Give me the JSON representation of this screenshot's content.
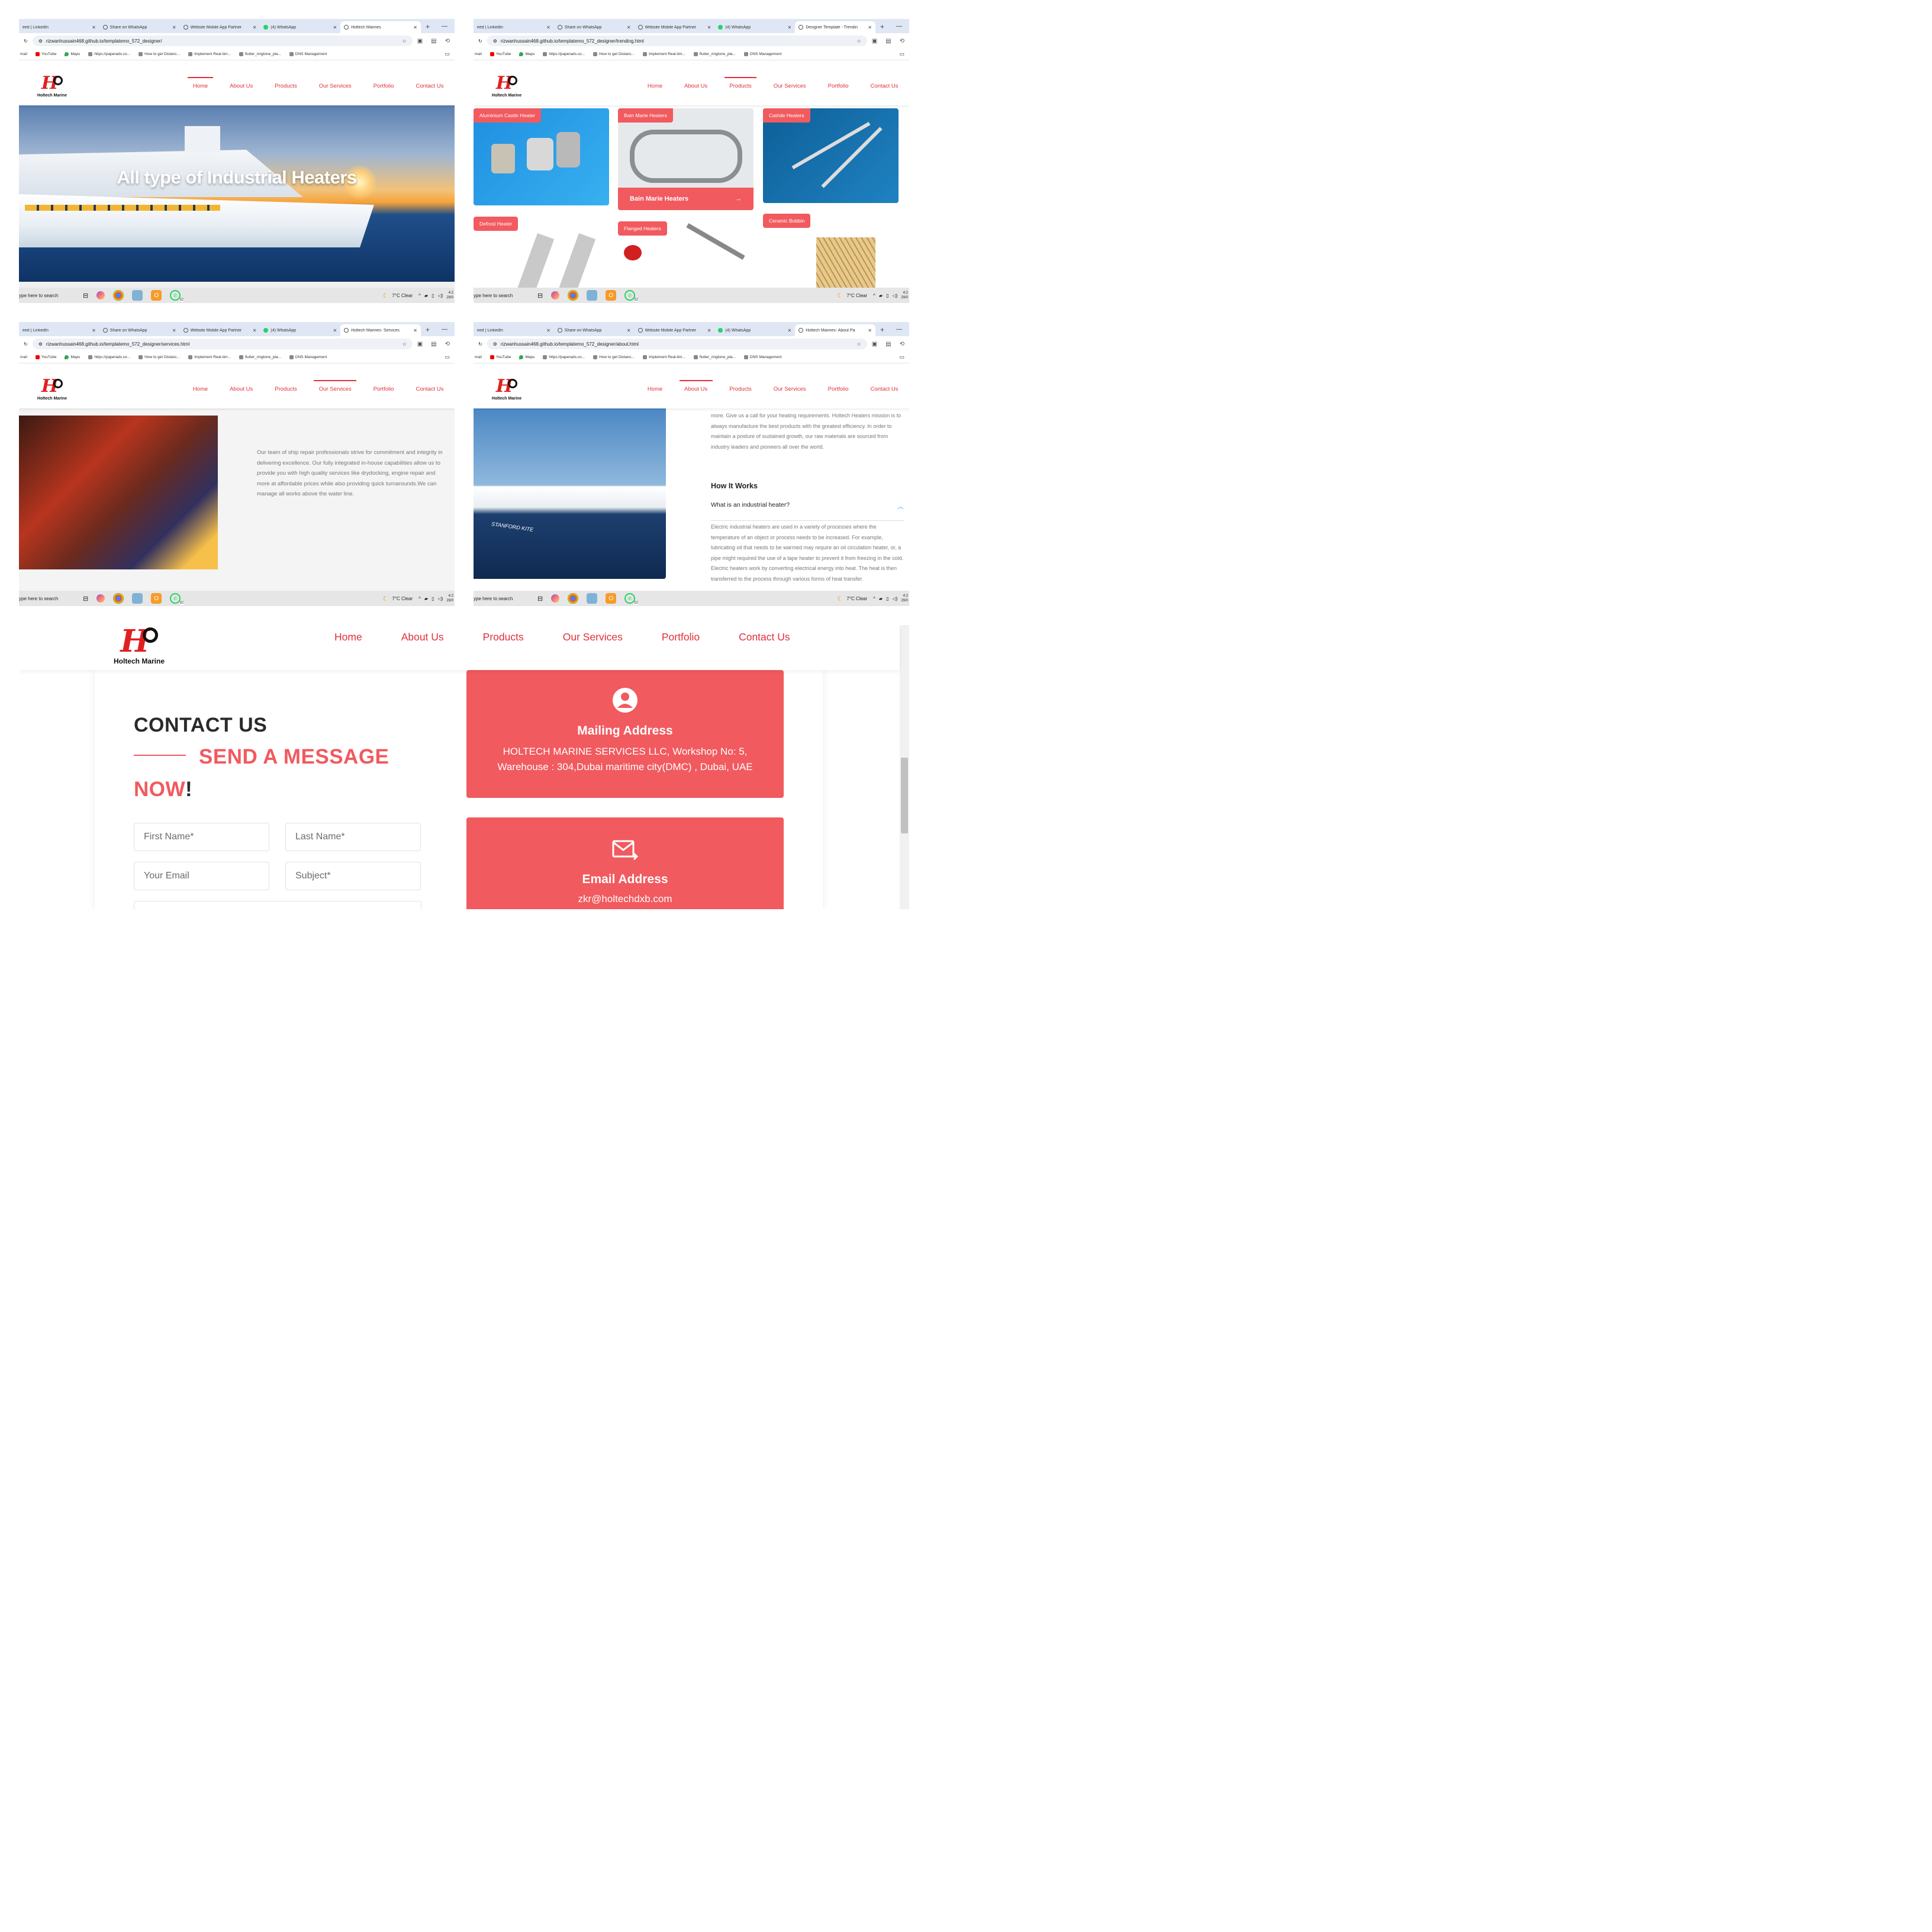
{
  "browser": {
    "tabs": [
      "eed | LinkedIn",
      "Share on WhatsApp",
      "Website Mobile App Partner",
      "(4) WhatsApp"
    ],
    "active_tabs": [
      "Holtech Marines",
      "Designer Template - Trendin",
      "Holtech Marines- Services",
      "Holtech Marines- About Pa"
    ],
    "urls": [
      "rizwanhussain468.github.io/templatemo_572_designer/",
      "rizwanhussain468.github.io/templatemo_572_designer/trending.html",
      "rizwanhussain468.github.io/templatemo_572_designer/services.html",
      "rizwanhussain468.github.io/templatemo_572_designer/about.html"
    ],
    "bookmarks": [
      "mail",
      "YouTube",
      "Maps",
      "https://paperads.co...",
      "How to get Distanc...",
      "Implement Real-tim...",
      "flutter_ringtone_pla...",
      "DNS Management"
    ]
  },
  "site": {
    "logo_text": "Holtech Marine",
    "nav": [
      "Home",
      "About Us",
      "Products",
      "Our Services",
      "Portfolio",
      "Contact Us"
    ]
  },
  "home": {
    "hero_title": "All type of Industrial Heaters"
  },
  "products": {
    "items": [
      "Aluminium Castin Heater",
      "Bain Marie Heaters",
      "Catride Heaters",
      "Defrost Heater",
      "Flanged Heaters",
      "Ceramic Bobbin"
    ],
    "hover_footer": "Bain Marie Heaters"
  },
  "services": {
    "text": "Our team of ship repair professionals strive for commitment and integrity in delivering excellence. Our fully integrated in-house capabilities allow us to provide you with high quality services like drydocking, engine repair and more at affordable prices while also providing quick turnarounds.We can manage all works above the water line."
  },
  "about": {
    "intro_text": "more. Give us a call for your heating requirements. Holtech Heaters mission is to always manufacture the best products with the greatest efficiency. In order to maintain a posture of sustained growth, our raw materials are sourced from industry leaders and pioneers all over the world.",
    "how_title": "How It Works",
    "faq_question": "What is an industrial heater?",
    "faq_answer": "Electric industrial heaters are used in a variety of processes where the temperature of an object or process needs to be increased. For example, lubricating oil that needs to be warmed may require an oil circulation heater, or, a pipe might required the use of a tape heater to prevent it from freezing in the cold. Electric heaters work by converting electrical energy into heat. The heat is then transferred to the process through various forms of heat transfer.",
    "ship_name": "STANFORD KITE"
  },
  "contact": {
    "title": "CONTACT US",
    "subtitle": "SEND A MESSAGE",
    "subtitle2": "NOW",
    "bang": "!",
    "placeholders": {
      "first_name": "First Name*",
      "last_name": "Last Name*",
      "email": "Your Email",
      "subject": "Subject*"
    },
    "mailing_title": "Mailing Address",
    "mailing_text": "HOLTECH MARINE SERVICES LLC, Workshop No: 5, Warehouse : 304,Dubai maritime city(DMC) , Dubai, UAE",
    "email_title": "Email Address",
    "email_value": "zkr@holtechdxb.com"
  },
  "taskbar": {
    "search": "ype here to search",
    "weather": "7°C  Clear",
    "whatsapp_badge": "92",
    "clock_time": "4:2",
    "clock_date": "29/0"
  },
  "colors": {
    "brand_red": "#f15a5e",
    "nav_red": "#e0303a"
  }
}
